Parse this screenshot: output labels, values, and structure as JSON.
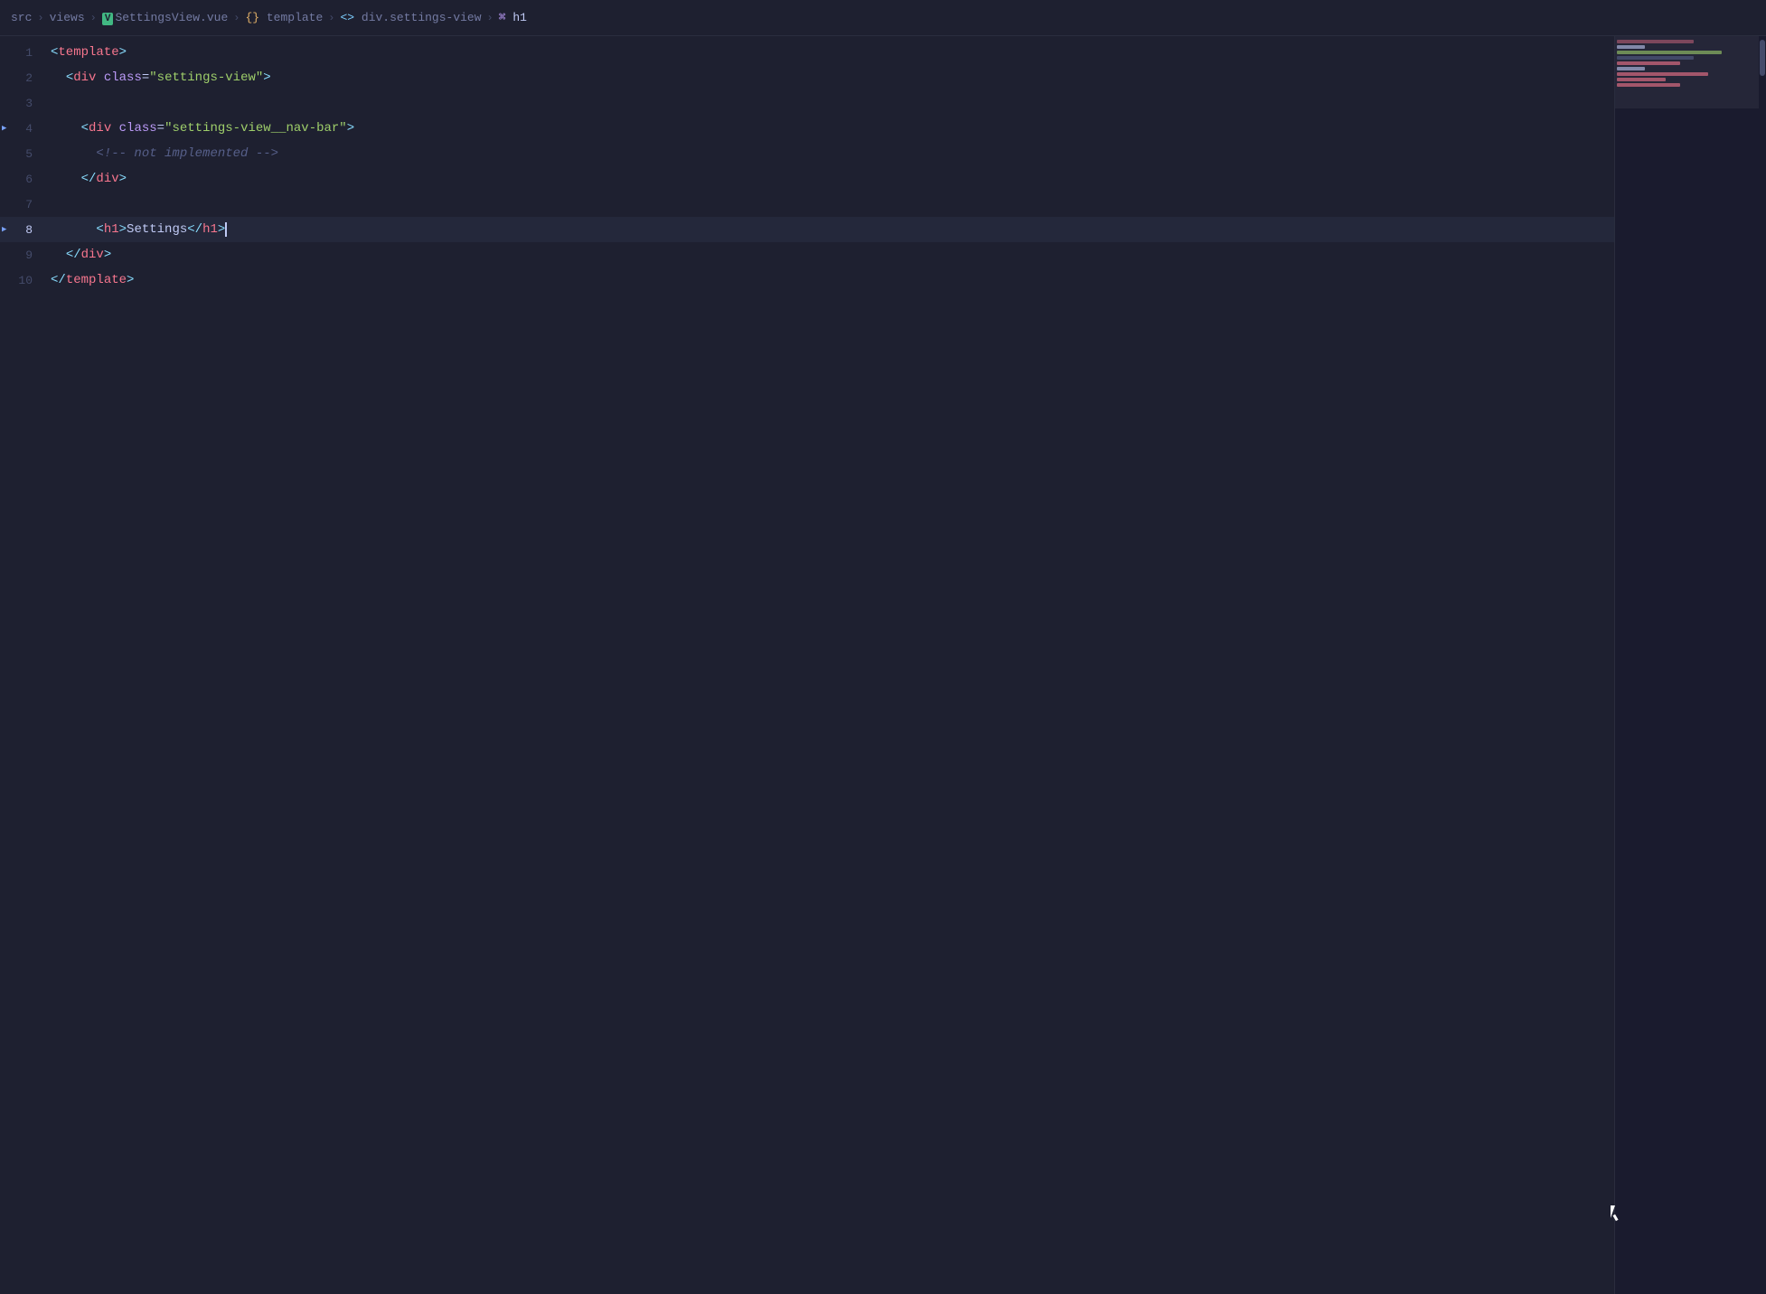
{
  "breadcrumb": {
    "items": [
      {
        "label": "src",
        "type": "folder"
      },
      {
        "label": "views",
        "type": "folder"
      },
      {
        "label": "SettingsView.vue",
        "type": "vue"
      },
      {
        "label": "template",
        "type": "curly"
      },
      {
        "label": "div.settings-view",
        "type": "div"
      },
      {
        "label": "h1",
        "type": "h1"
      }
    ],
    "separators": [
      ">",
      ">",
      ">",
      ">",
      ">"
    ]
  },
  "code": {
    "lines": [
      {
        "number": 1,
        "tokens": [
          {
            "text": "<",
            "class": "tag-bracket"
          },
          {
            "text": "template",
            "class": "tag-name"
          },
          {
            "text": ">",
            "class": "tag-bracket"
          }
        ]
      },
      {
        "number": 2,
        "tokens": [
          {
            "text": "  <",
            "class": "tag-bracket"
          },
          {
            "text": "div",
            "class": "tag-name"
          },
          {
            "text": " ",
            "class": "plain"
          },
          {
            "text": "class",
            "class": "attr-name"
          },
          {
            "text": "=",
            "class": "plain"
          },
          {
            "text": "\"settings-view\"",
            "class": "attr-value"
          },
          {
            "text": ">",
            "class": "tag-bracket"
          }
        ]
      },
      {
        "number": 3,
        "tokens": []
      },
      {
        "number": 4,
        "tokens": [
          {
            "text": "    <",
            "class": "tag-bracket"
          },
          {
            "text": "div",
            "class": "tag-name"
          },
          {
            "text": " ",
            "class": "plain"
          },
          {
            "text": "class",
            "class": "attr-name"
          },
          {
            "text": "=",
            "class": "plain"
          },
          {
            "text": "\"settings-view__nav-bar\"",
            "class": "attr-value"
          },
          {
            "text": ">",
            "class": "tag-bracket"
          }
        ]
      },
      {
        "number": 5,
        "tokens": [
          {
            "text": "      <!-- not implemented -->",
            "class": "comment"
          }
        ]
      },
      {
        "number": 6,
        "tokens": [
          {
            "text": "    </",
            "class": "tag-bracket"
          },
          {
            "text": "div",
            "class": "tag-name"
          },
          {
            "text": ">",
            "class": "tag-bracket"
          }
        ]
      },
      {
        "number": 7,
        "tokens": []
      },
      {
        "number": 8,
        "tokens": [
          {
            "text": "    <",
            "class": "tag-bracket"
          },
          {
            "text": "h1",
            "class": "tag-name"
          },
          {
            "text": ">",
            "class": "tag-bracket"
          },
          {
            "text": "Settings",
            "class": "text-content"
          },
          {
            "text": "</",
            "class": "tag-bracket"
          },
          {
            "text": "h1",
            "class": "tag-name"
          },
          {
            "text": ">",
            "class": "tag-bracket"
          }
        ],
        "active": true,
        "cursor": true
      },
      {
        "number": 9,
        "tokens": [
          {
            "text": "  </",
            "class": "tag-bracket"
          },
          {
            "text": "div",
            "class": "tag-name"
          },
          {
            "text": ">",
            "class": "tag-bracket"
          }
        ]
      },
      {
        "number": 10,
        "tokens": [
          {
            "text": "</",
            "class": "tag-bracket"
          },
          {
            "text": "template",
            "class": "tag-name"
          },
          {
            "text": ">",
            "class": "tag-bracket"
          }
        ]
      }
    ]
  },
  "minimap": {
    "lines": [
      {
        "width": "60%",
        "color": "#f7768e"
      },
      {
        "width": "80%",
        "color": "#9ece6a"
      },
      {
        "width": "20%",
        "color": "#c0caf5"
      },
      {
        "width": "90%",
        "color": "#9ece6a"
      },
      {
        "width": "70%",
        "color": "#565f89"
      },
      {
        "width": "50%",
        "color": "#f7768e"
      },
      {
        "width": "20%",
        "color": "#c0caf5"
      },
      {
        "width": "85%",
        "color": "#f7768e"
      },
      {
        "width": "40%",
        "color": "#f7768e"
      },
      {
        "width": "55%",
        "color": "#f7768e"
      }
    ]
  }
}
